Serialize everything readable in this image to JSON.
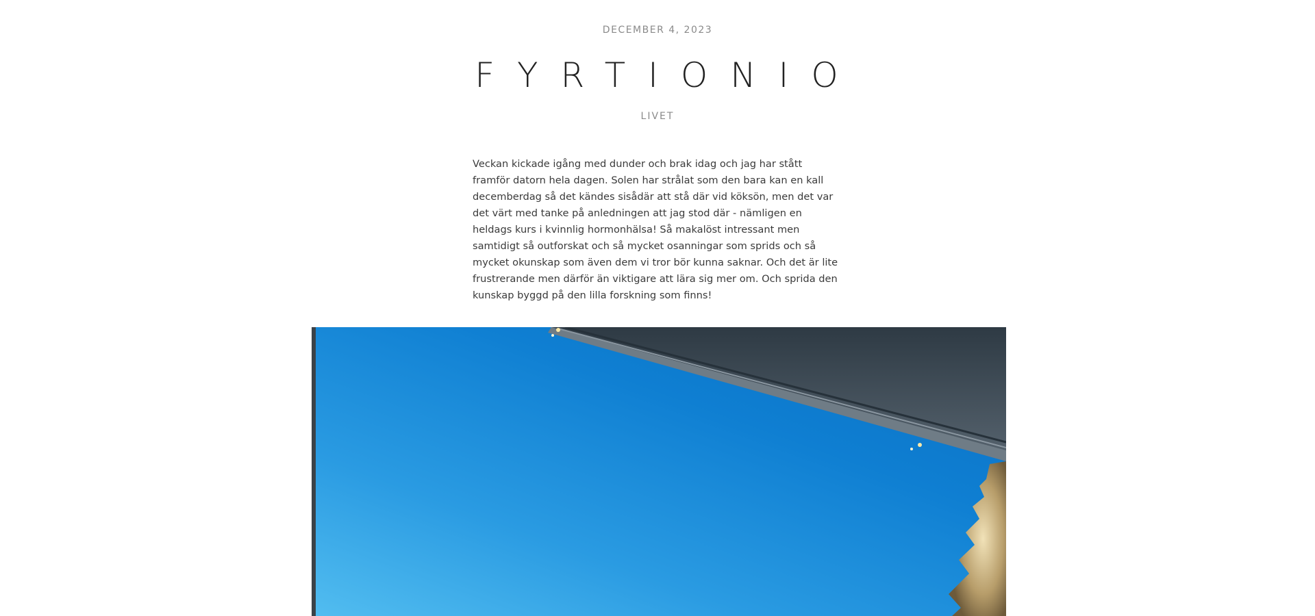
{
  "post": {
    "date": "DECEMBER 4, 2023",
    "title": "FYRTIONIO",
    "category": "LIVET",
    "body": "Veckan kickade igång med dunder och brak idag och jag har stått framför datorn hela dagen. Solen har strålat som den bara kan en kall decemberdag så det kändes sisådär att stå där vid köksön, men det var det värt med tanke på anledningen att jag stod där - nämligen en heldags kurs i kvinnlig hormonhälsa! Så makalöst intressant men samtidigt så outforskat och så mycket osanningar som sprids och så mycket okunskap som även dem vi tror bör kunna saknar. Och det är lite frustrerande men därför än viktigare att lära sig mer om. Och sprida den kunskap byggd på den lilla forskning som finns!"
  },
  "colors": {
    "sky_top": "#0a6ec2",
    "sky_bottom": "#52bdf0",
    "roof": "#3d4a55"
  }
}
